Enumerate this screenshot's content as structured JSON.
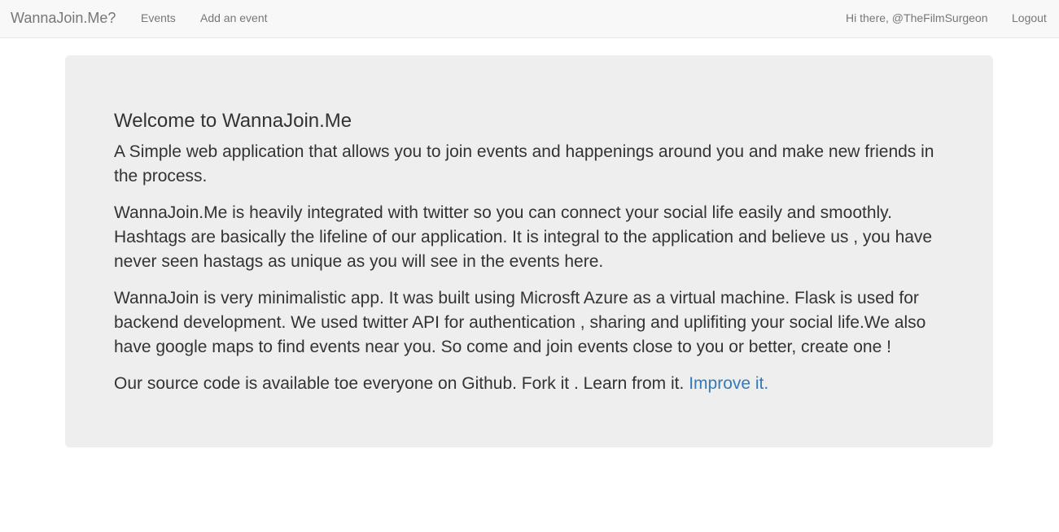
{
  "navbar": {
    "brand": "WannaJoin.Me?",
    "links": [
      {
        "label": "Events"
      },
      {
        "label": "Add an event"
      }
    ],
    "greeting": "Hi there, @TheFilmSurgeon",
    "logout": "Logout"
  },
  "jumbotron": {
    "title": "Welcome to WannaJoin.Me",
    "p1": "A Simple web application that allows you to join events and happenings around you and make new friends in the process.",
    "p2": "WannaJoin.Me is heavily integrated with twitter so you can connect your social life easily and smoothly. Hashtags are basically the lifeline of our application. It is integral to the application and believe us , you have never seen hastags as unique as you will see in the events here.",
    "p3": "WannaJoin is very minimalistic app. It was built using Microsft Azure as a virtual machine. Flask is used for backend development. We used twitter API for authentication , sharing and uplifiting your social life.We also have google maps to find events near you. So come and join events close to you or better, create one !",
    "p4_text": "Our source code is available toe everyone on Github. Fork it . Learn from it. ",
    "p4_link": "Improve it."
  },
  "colors": {
    "navbar_bg": "#f8f8f8",
    "jumbotron_bg": "#eeeeee",
    "link": "#337ab7",
    "nav_text": "#777777"
  }
}
